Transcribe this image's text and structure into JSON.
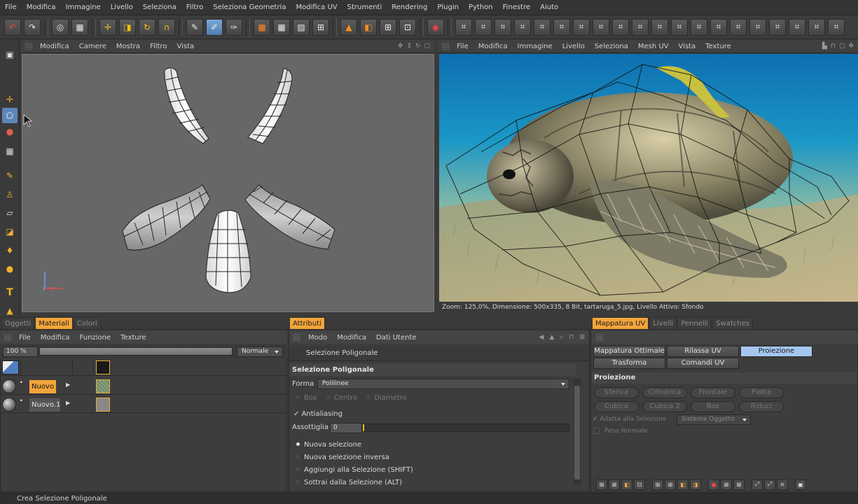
{
  "menubar": [
    "File",
    "Modifica",
    "Immagine",
    "Livello",
    "Seleziona",
    "Filtro",
    "Seleziona Geometria",
    "Modifica UV",
    "Strumenti",
    "Rendering",
    "Plugin",
    "Python",
    "Finestre",
    "Aiuto"
  ],
  "viewport": {
    "menu": [
      "Modifica",
      "Camere",
      "Mostra",
      "Filtro",
      "Vista"
    ],
    "axis_labels": {
      "y": "Y",
      "z": "Z"
    }
  },
  "uv_editor": {
    "menu": [
      "File",
      "Modifica",
      "Immagine",
      "Livello",
      "Seleziona",
      "Mesh UV",
      "Vista",
      "Texture"
    ],
    "status": "Zoom: 125,0%, Dimensione: 500x335, 8 Bit, tartaruga_5.jpg, Livello Attivo: Sfondo"
  },
  "materials_panel": {
    "tabs": [
      "Oggetti",
      "Materiali",
      "Colori"
    ],
    "active_tab": "Materiali",
    "menu": [
      "File",
      "Modifica",
      "Funzione",
      "Texture"
    ],
    "zoom": "100 %",
    "blend_mode": "Normale",
    "materials": [
      {
        "name": "Nuovo",
        "selected": true
      },
      {
        "name": "Nuovo.1",
        "selected": false
      }
    ]
  },
  "attributes_panel": {
    "tab": "Attributi",
    "menu": [
      "Modo",
      "Modifica",
      "Dati Utente"
    ],
    "title": "Selezione Poligonale",
    "section": "Selezione Poligonale",
    "forma_label": "Forma",
    "forma_value": "Polilinee",
    "shape_options": [
      "Box",
      "Centro",
      "Diametro"
    ],
    "antialiasing_label": "Antialiasing",
    "antialiasing_checked": true,
    "assottiglia_label": "Assottiglia",
    "assottiglia_value": "0",
    "selection_modes": [
      {
        "label": "Nuova selezione",
        "selected": true
      },
      {
        "label": "Nuova selezione inversa",
        "selected": false
      },
      {
        "label": "Aggiungi alla Selezione (SHIFT)",
        "selected": false
      },
      {
        "label": "Sottrai dalla Selezione (ALT)",
        "selected": false
      }
    ]
  },
  "uv_panel": {
    "tabs": [
      "Mappatura UV",
      "Livelli",
      "Pennelli",
      "Swatches"
    ],
    "active_tab": "Mappatura UV",
    "mode_buttons": [
      "Mappatura Ottimale",
      "Rilassa UV",
      "Proiezione",
      "Trasforma",
      "Comandi UV"
    ],
    "active_mode": "Proiezione",
    "section": "Proiezione",
    "projection_buttons": [
      "Sferica",
      "Cilindrica",
      "Frontale",
      "Piatta",
      "Cubica",
      "Cubica 2",
      "Box",
      "Riduci"
    ],
    "adapt_label": "Adatta alla Selezione",
    "adapt_dropdown": "Sistema Oggetto",
    "normal_weight_label": "Peso Normale"
  },
  "statusbar": {
    "text": "Crea Selezione Poligonale"
  },
  "colors": {
    "accent": "#f3a53b",
    "selection_blue": "#a5c6ef",
    "viewport_bg": "#666766"
  }
}
